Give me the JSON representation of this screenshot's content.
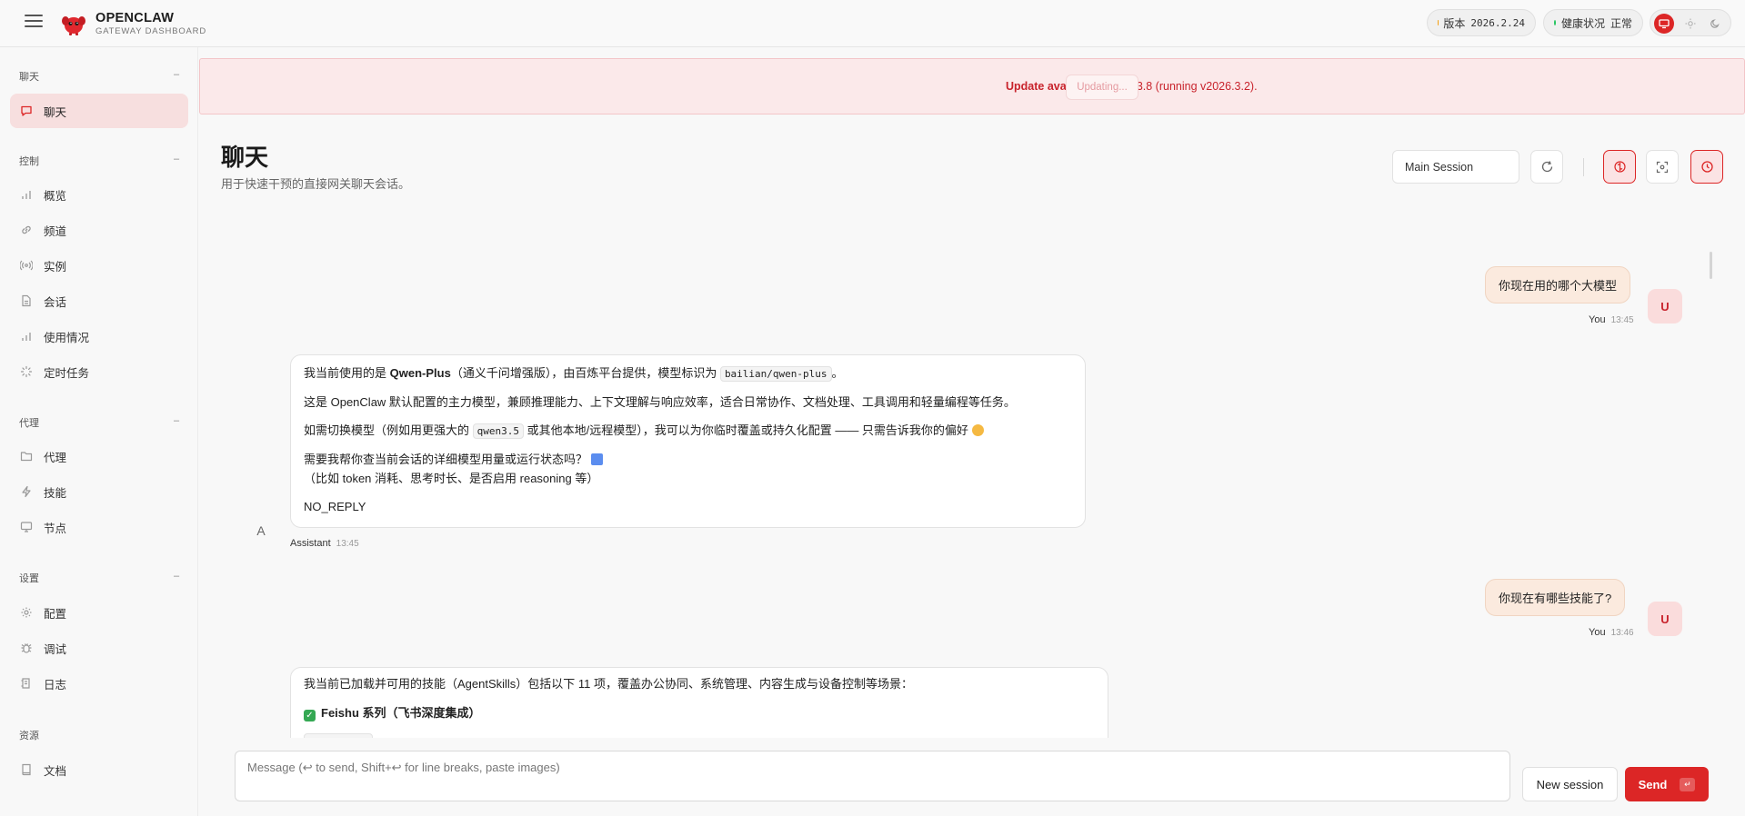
{
  "brand": {
    "title": "OPENCLAW",
    "subtitle": "GATEWAY DASHBOARD"
  },
  "status": {
    "version_label": "版本",
    "version_value": "2026.2.24",
    "health_label": "健康状况",
    "health_value": "正常",
    "version_dot_color": "#f59e0b",
    "health_dot_color": "#22c55e"
  },
  "theme_icons": [
    "monitor-icon",
    "sun-icon",
    "moon-icon"
  ],
  "sidebar": {
    "sections": [
      {
        "title": "聊天",
        "collapse": "–",
        "items": [
          {
            "label": "聊天",
            "icon": "chat-icon",
            "active": true
          }
        ]
      },
      {
        "title": "控制",
        "collapse": "–",
        "items": [
          {
            "label": "概览",
            "icon": "bar-chart-icon"
          },
          {
            "label": "频道",
            "icon": "link-icon"
          },
          {
            "label": "实例",
            "icon": "radio-icon"
          },
          {
            "label": "会话",
            "icon": "document-icon"
          },
          {
            "label": "使用情况",
            "icon": "bar-chart-icon"
          },
          {
            "label": "定时任务",
            "icon": "loader-icon"
          }
        ]
      },
      {
        "title": "代理",
        "collapse": "–",
        "items": [
          {
            "label": "代理",
            "icon": "folder-icon"
          },
          {
            "label": "技能",
            "icon": "lightning-icon"
          },
          {
            "label": "节点",
            "icon": "monitor-icon"
          }
        ]
      },
      {
        "title": "设置",
        "collapse": "–",
        "items": [
          {
            "label": "配置",
            "icon": "gear-icon"
          },
          {
            "label": "调试",
            "icon": "bug-icon"
          },
          {
            "label": "日志",
            "icon": "log-icon"
          }
        ]
      },
      {
        "title": "资源",
        "items": [
          {
            "label": "文档",
            "icon": "book-icon"
          }
        ]
      }
    ]
  },
  "banner": {
    "strong": "Update available:",
    "text": " v2026.3.8 (running v2026.3.2).",
    "button": "Updating..."
  },
  "page": {
    "title": "聊天",
    "subtitle": "用于快速干预的直接网关聊天会话。"
  },
  "toolbar": {
    "session_select": "Main Session"
  },
  "messages": {
    "m1": {
      "text": "你现在用的哪个大模型",
      "sender": "You",
      "time": "13:45",
      "avatar": "U"
    },
    "m2": {
      "sender": "Assistant",
      "time": "13:45",
      "avatar": "A",
      "l1_pre": "我当前使用的是 ",
      "l1_bold": "Qwen-Plus",
      "l1_mid": "（通义千问增强版），由百炼平台提供，模型标识为 ",
      "l1_code": "bailian/qwen-plus",
      "l1_post": "。",
      "l2": "这是 OpenClaw 默认配置的主力模型，兼顾推理能力、上下文理解与响应效率，适合日常协作、文档处理、工具调用和轻量编程等任务。",
      "l3_pre": "如需切换模型（例如用更强大的 ",
      "l3_code": "qwen3.5",
      "l3_post": " 或其他本地/远程模型），我可以为你临时覆盖或持久化配置 —— 只需告诉我你的偏好 ",
      "l4": "需要我帮你查当前会话的详细模型用量或运行状态吗？",
      "l5": "（比如 token 消耗、思考时长、是否启用 reasoning 等）",
      "l6": "NO_REPLY"
    },
    "m3": {
      "text": "你现在有哪些技能了?",
      "sender": "You",
      "time": "13:46",
      "avatar": "U"
    },
    "m4": {
      "l1": "我当前已加载并可用的技能（AgentSkills）包括以下 11 项，覆盖办公协同、系统管理、内容生成与设备控制等场景：",
      "l2": "Feishu 系列（飞书深度集成）"
    }
  },
  "composer": {
    "placeholder": "Message (↩ to send, Shift+↩ for line breaks, paste images)",
    "new_session": "New session",
    "send": "Send",
    "send_kbd": "↵"
  }
}
